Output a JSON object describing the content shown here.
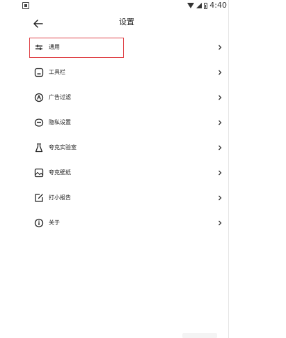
{
  "status_bar": {
    "time": "4:40"
  },
  "header": {
    "back_icon": "arrow-left-icon",
    "title": "设置"
  },
  "settings": {
    "items": [
      {
        "label": "通用",
        "icon": "sliders-icon"
      },
      {
        "label": "工具栏",
        "icon": "toolbar-icon"
      },
      {
        "label": "广告过滤",
        "icon": "ad-filter-icon"
      },
      {
        "label": "隐私设置",
        "icon": "privacy-mask-icon"
      },
      {
        "label": "夸克实验室",
        "icon": "flask-icon"
      },
      {
        "label": "夸克壁纸",
        "icon": "wallpaper-icon"
      },
      {
        "label": "打小报告",
        "icon": "report-edit-icon"
      },
      {
        "label": "关于",
        "icon": "info-icon"
      }
    ]
  },
  "colors": {
    "highlight": "#e0454a",
    "text": "#222222"
  }
}
